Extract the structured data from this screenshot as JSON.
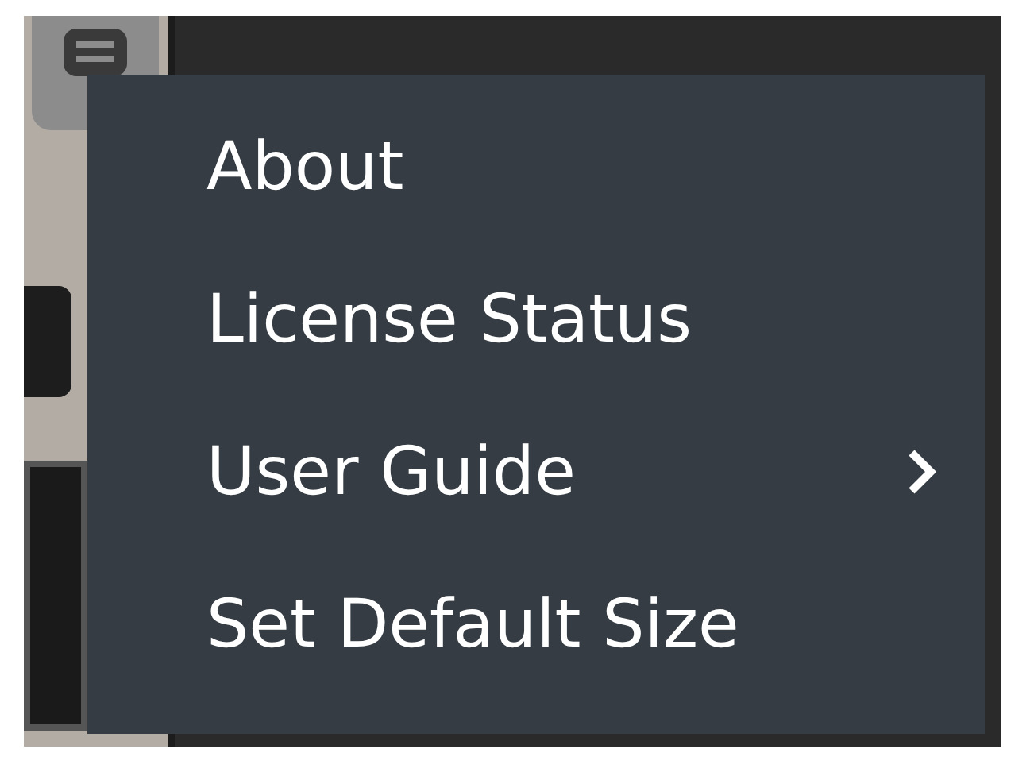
{
  "menu": {
    "items": [
      {
        "label": "About",
        "kind": "action"
      },
      {
        "label": "License Status",
        "kind": "action"
      },
      {
        "label": "User Guide",
        "kind": "submenu"
      },
      {
        "label": "Set Default Size",
        "kind": "action"
      }
    ]
  }
}
